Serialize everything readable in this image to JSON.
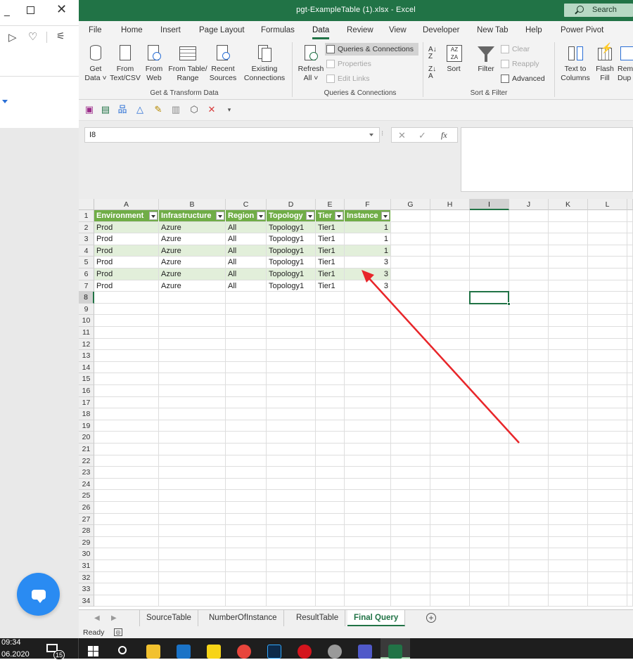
{
  "window": {
    "title": "pgt-ExampleTable (1).xlsx  -  Excel",
    "search_label": "Search"
  },
  "ribbon_tabs": [
    "File",
    "Home",
    "Insert",
    "Page Layout",
    "Formulas",
    "Data",
    "Review",
    "View",
    "Developer",
    "New Tab",
    "Help",
    "Power Pivot"
  ],
  "active_tab": "Data",
  "ribbon": {
    "get_data": [
      "Get",
      "Data ˅"
    ],
    "from_text": [
      "From",
      "Text/CSV"
    ],
    "from_web": [
      "From",
      "Web"
    ],
    "from_table": [
      "From Table/",
      "Range"
    ],
    "recent": [
      "Recent",
      "Sources"
    ],
    "existing": [
      "Existing",
      "Connections"
    ],
    "group1": "Get & Transform Data",
    "refresh": [
      "Refresh",
      "All ˅"
    ],
    "queries_connections": "Queries & Connections",
    "properties": "Properties",
    "edit_links": "Edit Links",
    "group2": "Queries & Connections",
    "sort": "Sort",
    "filter": "Filter",
    "clear": "Clear",
    "reapply": "Reapply",
    "advanced": "Advanced",
    "group3": "Sort & Filter",
    "text_to_columns": [
      "Text to",
      "Columns"
    ],
    "flash_fill": [
      "Flash",
      "Fill"
    ],
    "remove_dup": [
      "Rem",
      "Dup"
    ]
  },
  "formula_bar": {
    "name_box": "I8",
    "fx": "fx",
    "value": ""
  },
  "columns": [
    "A",
    "B",
    "C",
    "D",
    "E",
    "F",
    "G",
    "H",
    "I",
    "J",
    "K",
    "L"
  ],
  "selected_cell": "I8",
  "table": {
    "headers": [
      "Environment",
      "Infrastructure",
      "Region",
      "Topology",
      "Tier",
      "Instance"
    ],
    "rows": [
      [
        "Prod",
        "Azure",
        "All",
        "Topology1",
        "Tier1",
        "1"
      ],
      [
        "Prod",
        "Azure",
        "All",
        "Topology1",
        "Tier1",
        "1"
      ],
      [
        "Prod",
        "Azure",
        "All",
        "Topology1",
        "Tier1",
        "1"
      ],
      [
        "Prod",
        "Azure",
        "All",
        "Topology1",
        "Tier1",
        "3"
      ],
      [
        "Prod",
        "Azure",
        "All",
        "Topology1",
        "Tier1",
        "3"
      ],
      [
        "Prod",
        "Azure",
        "All",
        "Topology1",
        "Tier1",
        "3"
      ]
    ]
  },
  "row_numbers": [
    "1",
    "2",
    "3",
    "4",
    "5",
    "6",
    "7",
    "8",
    "9",
    "10",
    "11",
    "12",
    "13",
    "14",
    "15",
    "16",
    "17",
    "18",
    "19",
    "20",
    "21",
    "22",
    "23",
    "24",
    "25",
    "26",
    "27",
    "28",
    "29",
    "30",
    "31",
    "32",
    "33",
    "34"
  ],
  "sheets": [
    "SourceTable",
    "NumberOfInstance",
    "ResultTable",
    "Final Query"
  ],
  "active_sheet": "Final Query",
  "status": "Ready",
  "taskbar": {
    "time": "09:34",
    "date": "06.2020",
    "notif_count": "15"
  },
  "colors": {
    "excel_green": "#217346",
    "table_header": "#70ad47",
    "table_band": "#e2efda",
    "arrow": "#e8262a",
    "chat_button": "#2a8bf2"
  }
}
